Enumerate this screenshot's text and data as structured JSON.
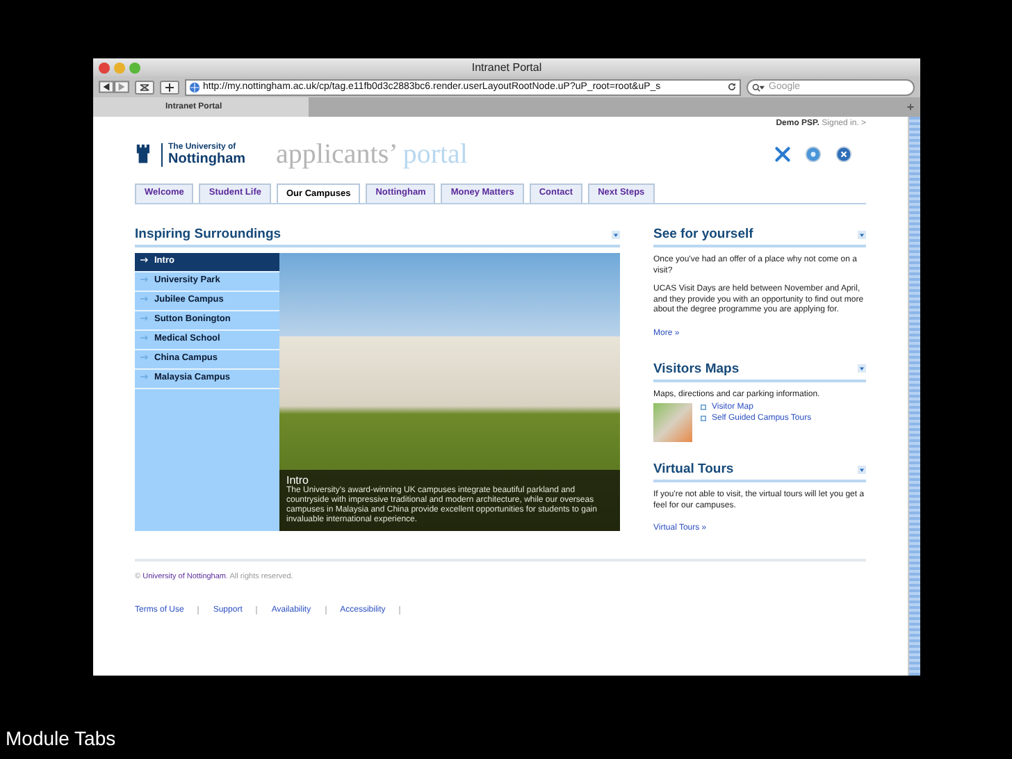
{
  "browser": {
    "title": "Intranet Portal",
    "url": "http://my.nottingham.ac.uk/cp/tag.e11fb0d3c2883bc6.render.userLayoutRootNode.uP?uP_root=root&uP_s",
    "search": {
      "placeholder": "Google"
    },
    "tab": "Intranet Portal"
  },
  "header": {
    "user": "Demo PSP.",
    "status": "Signed in. >",
    "logo_lines": [
      "The University of",
      "Nottingham"
    ],
    "portal_word_1": "applicants’",
    "portal_word_2": "portal"
  },
  "tabs": [
    {
      "label": "Welcome",
      "selected": false
    },
    {
      "label": "Student Life",
      "selected": false
    },
    {
      "label": "Our Campuses",
      "selected": true
    },
    {
      "label": "Nottingham",
      "selected": false
    },
    {
      "label": "Money Matters",
      "selected": false
    },
    {
      "label": "Contact",
      "selected": false
    },
    {
      "label": "Next Steps",
      "selected": false
    }
  ],
  "main": {
    "title": "Inspiring Surroundings",
    "menu": [
      {
        "label": "Intro",
        "selected": true
      },
      {
        "label": "University Park",
        "selected": false
      },
      {
        "label": "Jubilee Campus",
        "selected": false
      },
      {
        "label": "Sutton Bonington",
        "selected": false
      },
      {
        "label": "Medical School",
        "selected": false
      },
      {
        "label": "China Campus",
        "selected": false
      },
      {
        "label": "Malaysia Campus",
        "selected": false
      }
    ],
    "caption_title": "Intro",
    "caption_text": "The University's award-winning UK campuses integrate beautiful parkland and countryside with impressive traditional and modern architecture, while our overseas campuses in Malaysia and China provide excellent opportunities for students to gain invaluable international experience."
  },
  "sidebar": [
    {
      "title": "See for yourself",
      "paragraphs": [
        "Once you've had an offer of a place why not come on a visit?",
        "UCAS Visit Days are held between November and April, and they provide you with an opportunity to find out more about the degree programme you are applying for."
      ],
      "more": "More »"
    },
    {
      "title": "Visitors Maps",
      "paragraphs": [
        "Maps, directions and car parking information."
      ],
      "links": [
        "Visitor Map",
        "Self Guided Campus Tours"
      ]
    },
    {
      "title": "Virtual Tours",
      "paragraphs": [
        "If you're not able to visit, the virtual tours will let you get a feel for our campuses."
      ],
      "more": "Virtual Tours »"
    }
  ],
  "footer": {
    "copyright_sign": "©",
    "copyright_link": "University of Nottingham",
    "copyright_rest": ". All rights reserved.",
    "links": [
      "Terms of Use",
      "Support",
      "Availability",
      "Accessibility"
    ]
  },
  "slide_caption": "Module Tabs"
}
